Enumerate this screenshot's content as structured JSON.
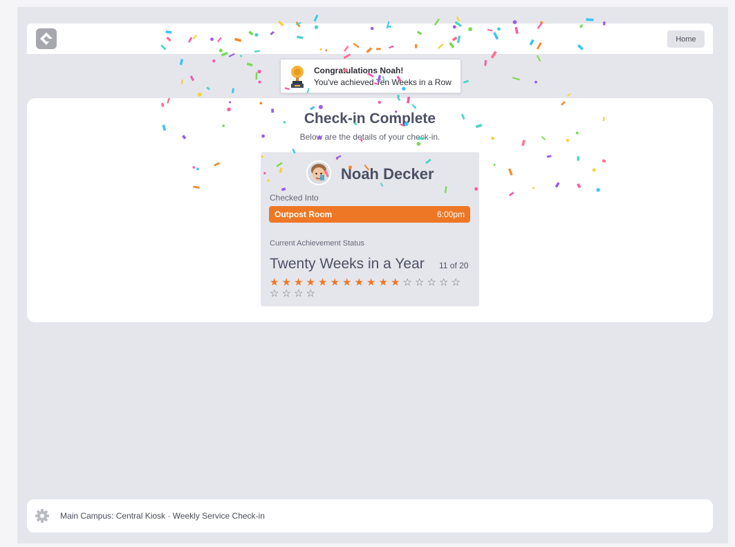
{
  "header": {
    "home_label": "Home",
    "logo_icon": "rock-logo-icon"
  },
  "toast": {
    "title": "Congratulations Noah!",
    "message": "You've achieved Ten Weeks in a Row",
    "icon": "trophy-icon"
  },
  "main": {
    "title": "Check-in Complete",
    "subtitle": "Below are the details of your check-in."
  },
  "person": {
    "name": "Noah Decker"
  },
  "checkin": {
    "label": "Checked Into",
    "room": "Outpost Room",
    "time": "6:00pm",
    "accent_color": "#ee7725"
  },
  "achievement": {
    "label": "Current Achievement Status",
    "name": "Twenty Weeks in a Year",
    "progress_text": "11 of 20",
    "completed": 11,
    "total": 20
  },
  "footer": {
    "text": "Main Campus: Central Kiosk · Weekly Service Check-in",
    "icon": "gear-icon"
  }
}
